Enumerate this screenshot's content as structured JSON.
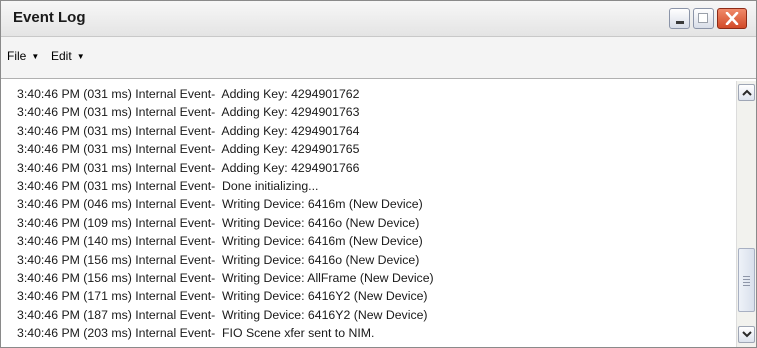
{
  "window": {
    "title": "Event Log"
  },
  "menubar": {
    "items": [
      {
        "label": "File"
      },
      {
        "label": "Edit"
      }
    ]
  },
  "log": {
    "lines": [
      "3:40:46 PM (031 ms) Internal Event-  Adding Key: 4294901762",
      "3:40:46 PM (031 ms) Internal Event-  Adding Key: 4294901763",
      "3:40:46 PM (031 ms) Internal Event-  Adding Key: 4294901764",
      "3:40:46 PM (031 ms) Internal Event-  Adding Key: 4294901765",
      "3:40:46 PM (031 ms) Internal Event-  Adding Key: 4294901766",
      "3:40:46 PM (031 ms) Internal Event-  Done initializing...",
      "3:40:46 PM (046 ms) Internal Event-  Writing Device: 6416m (New Device)",
      "3:40:46 PM (109 ms) Internal Event-  Writing Device: 6416o (New Device)",
      "3:40:46 PM (140 ms) Internal Event-  Writing Device: 6416m (New Device)",
      "3:40:46 PM (156 ms) Internal Event-  Writing Device: 6416o (New Device)",
      "3:40:46 PM (156 ms) Internal Event-  Writing Device: AllFrame (New Device)",
      "3:40:46 PM (171 ms) Internal Event-  Writing Device: 6416Y2 (New Device)",
      "3:40:46 PM (187 ms) Internal Event-  Writing Device: 6416Y2 (New Device)",
      "3:40:46 PM (203 ms) Internal Event-  FIO Scene xfer sent to NIM."
    ]
  },
  "scrollbar": {
    "scroll_position": 0.9
  },
  "icons": {
    "minimize": "minimize-icon",
    "maximize": "maximize-icon",
    "close": "close-icon",
    "scroll_up": "scroll-up-arrow-icon",
    "scroll_down": "scroll-down-arrow-icon",
    "menu_dropdown": "dropdown-arrow-icon"
  },
  "colors": {
    "close_button": "#d24a28",
    "title_text": "#1a1a1a",
    "log_text": "#1a1a1a"
  }
}
